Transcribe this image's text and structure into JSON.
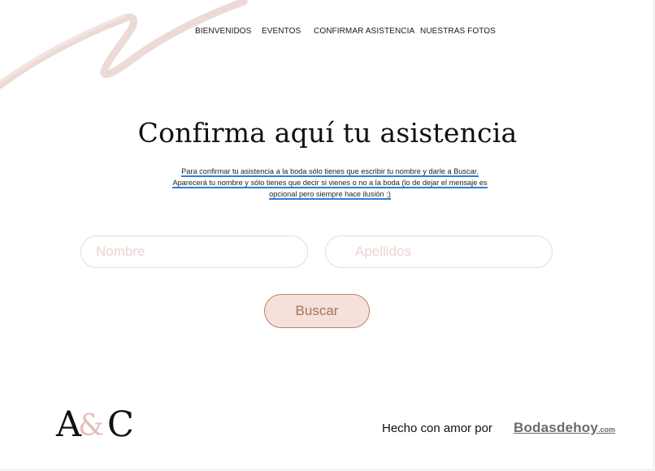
{
  "nav": {
    "items": [
      "BIENVENIDOS",
      "EVENTOS",
      "CONFIRMAR ASISTENCIA",
      "NUESTRAS FOTOS"
    ]
  },
  "main": {
    "title": "Confirma aquí tu asistencia",
    "description": "Para confirmar tu asistencia a la boda sólo tienes que escribir tu nombre y darle a Buscar. Aparecerá tu nombre y sólo tienes que decir si vienes o no a la boda (lo de dejar el mensaje es opcional pero siempre hace ilusión :)",
    "form": {
      "nombre_placeholder": "Nombre",
      "nombre_value": "",
      "apellidos_placeholder": "Apellidos",
      "apellidos_value": "",
      "search_label": "Buscar"
    }
  },
  "footer": {
    "logo": {
      "first": "A",
      "amp": "&",
      "second": "C"
    },
    "credit": "Hecho con amor por",
    "brand_name": "Bodasdehoy",
    "brand_suffix": ".com"
  },
  "colors": {
    "accent_pink": "#f5e0da",
    "accent_brown": "#b6856a",
    "placeholder": "#ecd3cf",
    "underline_blue": "#2f80d6"
  }
}
